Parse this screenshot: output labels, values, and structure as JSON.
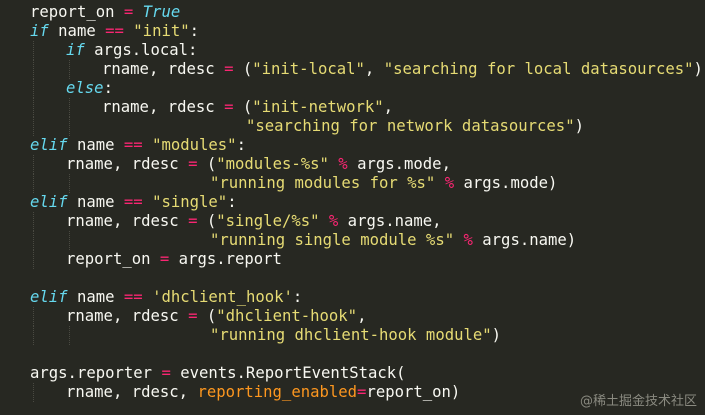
{
  "colors": {
    "background": "#272822",
    "text": "#f8f8f2",
    "operator": "#f92672",
    "keyword": "#66d9ef",
    "string": "#e6db74",
    "keyword_argument": "#fd971f"
  },
  "code_lines": [
    {
      "indent": 0,
      "tokens": [
        {
          "t": "name",
          "v": "report_on "
        },
        {
          "t": "op",
          "v": "="
        },
        {
          "t": "name",
          "v": " "
        },
        {
          "t": "const",
          "v": "True"
        }
      ]
    },
    {
      "indent": 0,
      "tokens": [
        {
          "t": "kw",
          "v": "if"
        },
        {
          "t": "name",
          "v": " name "
        },
        {
          "t": "op",
          "v": "=="
        },
        {
          "t": "name",
          "v": " "
        },
        {
          "t": "str",
          "v": "\"init\""
        },
        {
          "t": "punct",
          "v": ":"
        }
      ]
    },
    {
      "indent": 1,
      "tokens": [
        {
          "t": "kw",
          "v": "if"
        },
        {
          "t": "name",
          "v": " args.local:"
        }
      ]
    },
    {
      "indent": 2,
      "tokens": [
        {
          "t": "name",
          "v": "rname, rdesc "
        },
        {
          "t": "op",
          "v": "="
        },
        {
          "t": "punct",
          "v": " ("
        },
        {
          "t": "str",
          "v": "\"init-local\""
        },
        {
          "t": "punct",
          "v": ", "
        },
        {
          "t": "str",
          "v": "\"searching for local datasources\""
        },
        {
          "t": "punct",
          "v": ")"
        }
      ]
    },
    {
      "indent": 1,
      "tokens": [
        {
          "t": "kw",
          "v": "else"
        },
        {
          "t": "punct",
          "v": ":"
        }
      ]
    },
    {
      "indent": 2,
      "tokens": [
        {
          "t": "name",
          "v": "rname, rdesc "
        },
        {
          "t": "op",
          "v": "="
        },
        {
          "t": "punct",
          "v": " ("
        },
        {
          "t": "str",
          "v": "\"init-network\""
        },
        {
          "t": "punct",
          "v": ","
        }
      ]
    },
    {
      "indent": 6,
      "tokens": [
        {
          "t": "str",
          "v": "\"searching for network datasources\""
        },
        {
          "t": "punct",
          "v": ")"
        }
      ]
    },
    {
      "indent": 0,
      "tokens": [
        {
          "t": "kw",
          "v": "elif"
        },
        {
          "t": "name",
          "v": " name "
        },
        {
          "t": "op",
          "v": "=="
        },
        {
          "t": "name",
          "v": " "
        },
        {
          "t": "str",
          "v": "\"modules\""
        },
        {
          "t": "punct",
          "v": ":"
        }
      ]
    },
    {
      "indent": 1,
      "tokens": [
        {
          "t": "name",
          "v": "rname, rdesc "
        },
        {
          "t": "op",
          "v": "="
        },
        {
          "t": "punct",
          "v": " ("
        },
        {
          "t": "str",
          "v": "\"modules-%s\""
        },
        {
          "t": "name",
          "v": " "
        },
        {
          "t": "op",
          "v": "%"
        },
        {
          "t": "name",
          "v": " args.mode,"
        }
      ]
    },
    {
      "indent": 5,
      "tokens": [
        {
          "t": "str",
          "v": "\"running modules for %s\""
        },
        {
          "t": "name",
          "v": " "
        },
        {
          "t": "op",
          "v": "%"
        },
        {
          "t": "name",
          "v": " args.mode)"
        }
      ]
    },
    {
      "indent": 0,
      "tokens": [
        {
          "t": "kw",
          "v": "elif"
        },
        {
          "t": "name",
          "v": " name "
        },
        {
          "t": "op",
          "v": "=="
        },
        {
          "t": "name",
          "v": " "
        },
        {
          "t": "str",
          "v": "\"single\""
        },
        {
          "t": "punct",
          "v": ":"
        }
      ]
    },
    {
      "indent": 1,
      "tokens": [
        {
          "t": "name",
          "v": "rname, rdesc "
        },
        {
          "t": "op",
          "v": "="
        },
        {
          "t": "punct",
          "v": " ("
        },
        {
          "t": "str",
          "v": "\"single/%s\""
        },
        {
          "t": "name",
          "v": " "
        },
        {
          "t": "op",
          "v": "%"
        },
        {
          "t": "name",
          "v": " args.name,"
        }
      ]
    },
    {
      "indent": 5,
      "tokens": [
        {
          "t": "str",
          "v": "\"running single module %s\""
        },
        {
          "t": "name",
          "v": " "
        },
        {
          "t": "op",
          "v": "%"
        },
        {
          "t": "name",
          "v": " args.name)"
        }
      ]
    },
    {
      "indent": 1,
      "tokens": [
        {
          "t": "name",
          "v": "report_on "
        },
        {
          "t": "op",
          "v": "="
        },
        {
          "t": "name",
          "v": " args.report"
        }
      ]
    },
    {
      "indent": 0,
      "tokens": []
    },
    {
      "indent": 0,
      "tokens": [
        {
          "t": "kw",
          "v": "elif"
        },
        {
          "t": "name",
          "v": " name "
        },
        {
          "t": "op",
          "v": "=="
        },
        {
          "t": "name",
          "v": " "
        },
        {
          "t": "str",
          "v": "'dhclient_hook'"
        },
        {
          "t": "punct",
          "v": ":"
        }
      ]
    },
    {
      "indent": 1,
      "tokens": [
        {
          "t": "name",
          "v": "rname, rdesc "
        },
        {
          "t": "op",
          "v": "="
        },
        {
          "t": "punct",
          "v": " ("
        },
        {
          "t": "str",
          "v": "\"dhclient-hook\""
        },
        {
          "t": "punct",
          "v": ","
        }
      ]
    },
    {
      "indent": 5,
      "tokens": [
        {
          "t": "str",
          "v": "\"running dhclient-hook module\""
        },
        {
          "t": "punct",
          "v": ")"
        }
      ]
    },
    {
      "indent": 0,
      "tokens": []
    },
    {
      "indent": 0,
      "tokens": [
        {
          "t": "name",
          "v": "args.reporter "
        },
        {
          "t": "op",
          "v": "="
        },
        {
          "t": "name",
          "v": " events.ReportEventStack("
        }
      ]
    },
    {
      "indent": 1,
      "tokens": [
        {
          "t": "name",
          "v": "rname, rdesc, "
        },
        {
          "t": "kwarg",
          "v": "reporting_enabled"
        },
        {
          "t": "op",
          "v": "="
        },
        {
          "t": "name",
          "v": "report_on)"
        }
      ]
    }
  ],
  "watermark": "@稀土掘金技术社区"
}
